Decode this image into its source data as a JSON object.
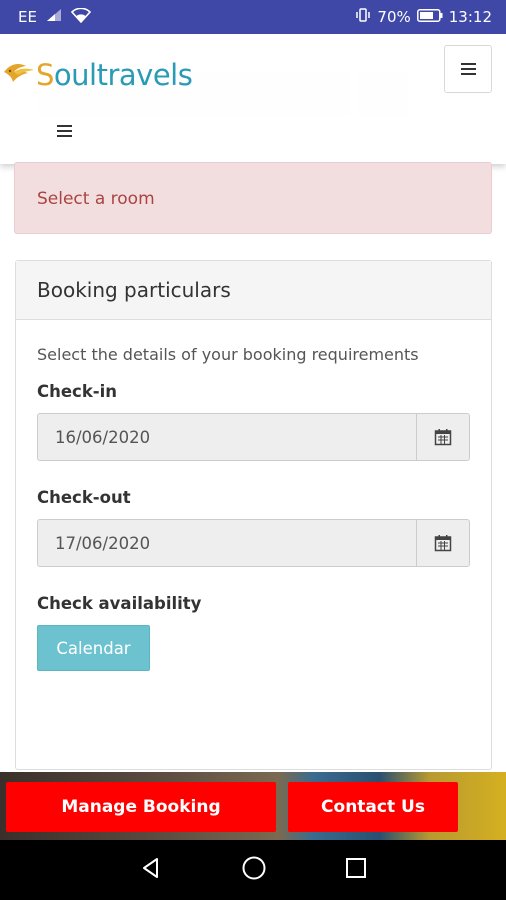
{
  "status_bar": {
    "carrier": "EE",
    "battery": "70%",
    "time": "13:12",
    "bg_color": "#3f48a6",
    "icons": [
      "signal-icon",
      "wifi-icon",
      "vibrate-icon",
      "battery-icon"
    ]
  },
  "header": {
    "logo_text_s": "S",
    "logo_text_rest": "oultravels",
    "menu_icon": "hamburger-icon"
  },
  "alert": {
    "text": "Select a room",
    "bg_color": "#f2dede",
    "text_color": "#a94442"
  },
  "booking": {
    "title": "Booking particulars",
    "help_text": "Select the details of your booking requirements",
    "checkin_label": "Check-in",
    "checkin_value": "16/06/2020",
    "checkout_label": "Check-out",
    "checkout_value": "17/06/2020",
    "availability_label": "Check availability",
    "calendar_button": "Calendar",
    "calendar_icon": "calendar-icon",
    "button_color": "#6cc3cf"
  },
  "footer": {
    "manage_booking": "Manage Booking",
    "contact_us": "Contact Us",
    "button_color": "#ff0000"
  },
  "nav": {
    "icons": [
      "back-icon",
      "home-icon",
      "recents-icon"
    ]
  }
}
